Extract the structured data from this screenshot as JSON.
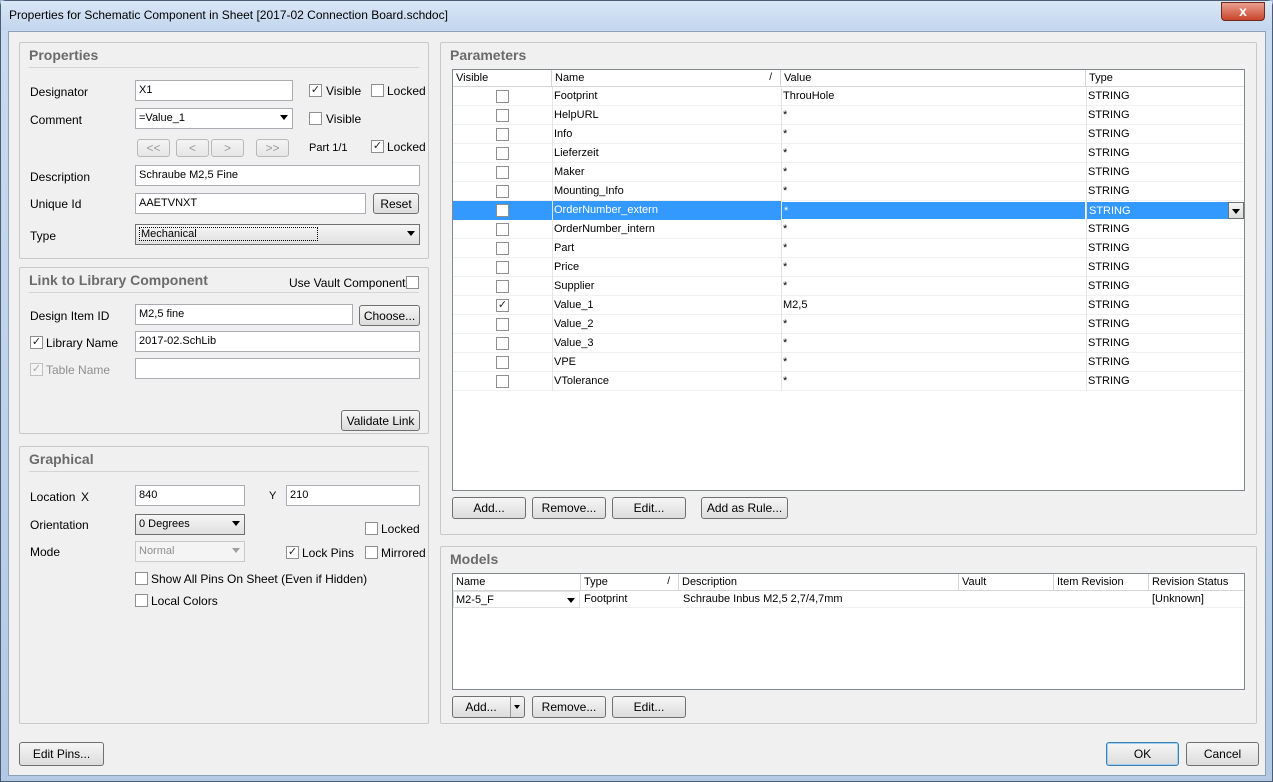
{
  "window": {
    "title": "Properties for Schematic Component in Sheet [2017-02 Connection Board.schdoc]",
    "close": "x"
  },
  "properties": {
    "title": "Properties",
    "designator_label": "Designator",
    "designator_value": "X1",
    "visible_label": "Visible",
    "locked_label": "Locked",
    "comment_label": "Comment",
    "comment_value": "=Value_1",
    "comment_visible_label": "Visible",
    "part_nav": [
      "<<",
      "<",
      ">",
      ">>"
    ],
    "part_label": "Part 1/1",
    "part_locked_label": "Locked",
    "description_label": "Description",
    "description_value": "Schraube M2,5 Fine",
    "unique_id_label": "Unique Id",
    "unique_id_value": "AAETVNXT",
    "reset_label": "Reset",
    "type_label": "Type",
    "type_value": "Mechanical"
  },
  "library": {
    "title": "Link to Library Component",
    "use_vault_label": "Use Vault Component",
    "design_item_label": "Design Item ID",
    "design_item_value": "M2,5 fine",
    "choose_label": "Choose...",
    "library_name_label": "Library Name",
    "library_name_value": "2017-02.SchLib",
    "table_name_label": "Table Name",
    "table_name_value": "",
    "validate_label": "Validate Link"
  },
  "graphical": {
    "title": "Graphical",
    "location_label": "Location",
    "x_label": "X",
    "x_value": "840",
    "y_label": "Y",
    "y_value": "210",
    "orientation_label": "Orientation",
    "orientation_value": "0 Degrees",
    "locked_label": "Locked",
    "mode_label": "Mode",
    "mode_value": "Normal",
    "lock_pins_label": "Lock Pins",
    "mirrored_label": "Mirrored",
    "show_all_pins_label": "Show All Pins On Sheet (Even if Hidden)",
    "local_colors_label": "Local Colors"
  },
  "parameters": {
    "title": "Parameters",
    "columns": [
      "Visible",
      "Name",
      "Value",
      "Type"
    ],
    "sort_mark": "/",
    "rows": [
      {
        "visible": false,
        "name": "Footprint",
        "value": "ThrouHole",
        "type": "STRING"
      },
      {
        "visible": false,
        "name": "HelpURL",
        "value": "*",
        "type": "STRING"
      },
      {
        "visible": false,
        "name": "Info",
        "value": "*",
        "type": "STRING"
      },
      {
        "visible": false,
        "name": "Lieferzeit",
        "value": "*",
        "type": "STRING"
      },
      {
        "visible": false,
        "name": "Maker",
        "value": "*",
        "type": "STRING"
      },
      {
        "visible": false,
        "name": "Mounting_Info",
        "value": "*",
        "type": "STRING"
      },
      {
        "visible": false,
        "name": "OrderNumber_extern",
        "value": "*",
        "type": "STRING",
        "selected": true
      },
      {
        "visible": false,
        "name": "OrderNumber_intern",
        "value": "*",
        "type": "STRING"
      },
      {
        "visible": false,
        "name": "Part",
        "value": "*",
        "type": "STRING"
      },
      {
        "visible": false,
        "name": "Price",
        "value": "*",
        "type": "STRING"
      },
      {
        "visible": false,
        "name": "Supplier",
        "value": "*",
        "type": "STRING"
      },
      {
        "visible": true,
        "name": "Value_1",
        "value": "M2,5",
        "type": "STRING"
      },
      {
        "visible": false,
        "name": "Value_2",
        "value": "*",
        "type": "STRING"
      },
      {
        "visible": false,
        "name": "Value_3",
        "value": "*",
        "type": "STRING"
      },
      {
        "visible": false,
        "name": "VPE",
        "value": "*",
        "type": "STRING"
      },
      {
        "visible": false,
        "name": "VTolerance",
        "value": "*",
        "type": "STRING"
      }
    ],
    "add_label": "Add...",
    "remove_label": "Remove...",
    "edit_label": "Edit...",
    "add_rule_label": "Add as Rule..."
  },
  "models": {
    "title": "Models",
    "columns": [
      "Name",
      "Type",
      "Description",
      "Vault",
      "Item Revision",
      "Revision Status"
    ],
    "sort_mark": "/",
    "rows": [
      {
        "name": "M2-5_F",
        "type": "Footprint",
        "description": "Schraube Inbus M2,5 2,7/4,7mm",
        "vault": "",
        "item_revision": "",
        "revision_status": "[Unknown]"
      }
    ],
    "add_label": "Add...",
    "remove_label": "Remove...",
    "edit_label": "Edit..."
  },
  "footer": {
    "edit_pins_label": "Edit Pins...",
    "ok_label": "OK",
    "cancel_label": "Cancel"
  }
}
